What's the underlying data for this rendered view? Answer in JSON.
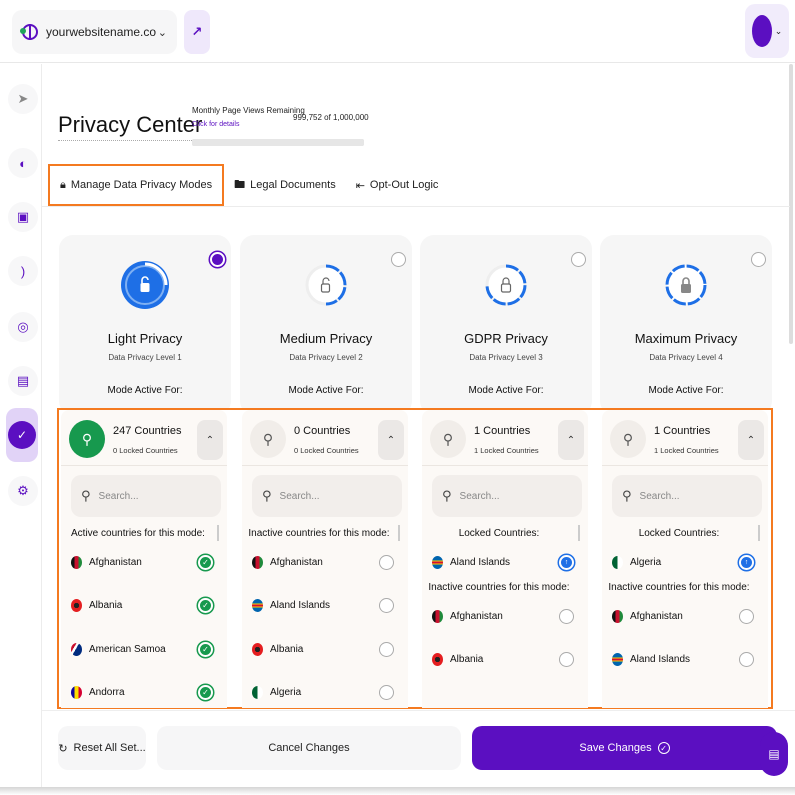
{
  "topbar": {
    "site_name": "yourwebsitename.co",
    "site_icon": "globe-icon",
    "external_link_icon": "external-link-icon",
    "user_menu_icon": "avatar"
  },
  "sidebar": {
    "items": [
      {
        "name": "collapse",
        "icon": "arrow-right-circle-icon"
      },
      {
        "name": "dashboard",
        "icon": "pie-chart-icon"
      },
      {
        "name": "shop",
        "icon": "shopping-bag-icon"
      },
      {
        "name": "analytics",
        "icon": "signal-icon"
      },
      {
        "name": "scan",
        "icon": "focus-scan-icon"
      },
      {
        "name": "messages",
        "icon": "chat-icon"
      },
      {
        "name": "privacy",
        "icon": "shield-check-icon",
        "active": true
      },
      {
        "name": "settings",
        "icon": "gear-icon"
      }
    ]
  },
  "header": {
    "title": "Privacy Center",
    "page_views_label": "Monthly Page Views Remaining",
    "page_views_link": "Click for details",
    "page_views_count": "999,752 of 1,000,000",
    "page_views_remaining_fraction": 0.99975
  },
  "tabs": [
    {
      "label": "Manage Data Privacy Modes",
      "icon": "lock-icon",
      "active": true
    },
    {
      "label": "Legal Documents",
      "icon": "folder-icon",
      "active": false
    },
    {
      "label": "Opt-Out Logic",
      "icon": "exit-icon",
      "active": false
    }
  ],
  "modes": [
    {
      "title": "Light Privacy",
      "level": "Data Privacy Level 1",
      "active_for": "Mode Active For:",
      "selected": true,
      "countries": "247 Countries",
      "locked": "0 Locked Countries",
      "search_placeholder": "Search...",
      "sections": [
        {
          "label": "Active countries for this mode:",
          "rows": [
            {
              "name": "Afghanistan",
              "state": "checked"
            },
            {
              "name": "Albania",
              "state": "checked"
            },
            {
              "name": "American Samoa",
              "state": "checked"
            },
            {
              "name": "Andorra",
              "state": "checked"
            }
          ]
        }
      ]
    },
    {
      "title": "Medium Privacy",
      "level": "Data Privacy Level 2",
      "active_for": "Mode Active For:",
      "selected": false,
      "countries": "0 Countries",
      "locked": "0 Locked Countries",
      "search_placeholder": "Search...",
      "sections": [
        {
          "label": "Inactive countries for this mode:",
          "rows": [
            {
              "name": "Afghanistan",
              "state": "empty"
            },
            {
              "name": "Aland Islands",
              "state": "empty"
            },
            {
              "name": "Albania",
              "state": "empty"
            },
            {
              "name": "Algeria",
              "state": "empty"
            }
          ]
        }
      ]
    },
    {
      "title": "GDPR Privacy",
      "level": "Data Privacy Level 3",
      "active_for": "Mode Active For:",
      "selected": false,
      "countries": "1 Countries",
      "locked": "1 Locked Countries",
      "search_placeholder": "Search...",
      "sections": [
        {
          "label": "Locked Countries:",
          "rows": [
            {
              "name": "Aland Islands",
              "state": "locked"
            }
          ]
        },
        {
          "label": "Inactive countries for this mode:",
          "rows": [
            {
              "name": "Afghanistan",
              "state": "empty"
            },
            {
              "name": "Albania",
              "state": "empty"
            }
          ]
        }
      ]
    },
    {
      "title": "Maximum Privacy",
      "level": "Data Privacy Level 4",
      "active_for": "Mode Active For:",
      "selected": false,
      "countries": "1 Countries",
      "locked": "1 Locked Countries",
      "search_placeholder": "Search...",
      "sections": [
        {
          "label": "Locked Countries:",
          "rows": [
            {
              "name": "Algeria",
              "state": "locked"
            }
          ]
        },
        {
          "label": "Inactive countries for this mode:",
          "rows": [
            {
              "name": "Afghanistan",
              "state": "empty"
            },
            {
              "name": "Aland Islands",
              "state": "empty"
            }
          ]
        }
      ]
    }
  ],
  "footer": {
    "reset_label": "Reset All Set...",
    "cancel_label": "Cancel Changes",
    "save_label": "Save Changes"
  },
  "colors": {
    "brand": "#5b0fc1",
    "highlight": "#f47a20",
    "active_green": "#17994e",
    "locked_blue": "#1e6fe6"
  }
}
